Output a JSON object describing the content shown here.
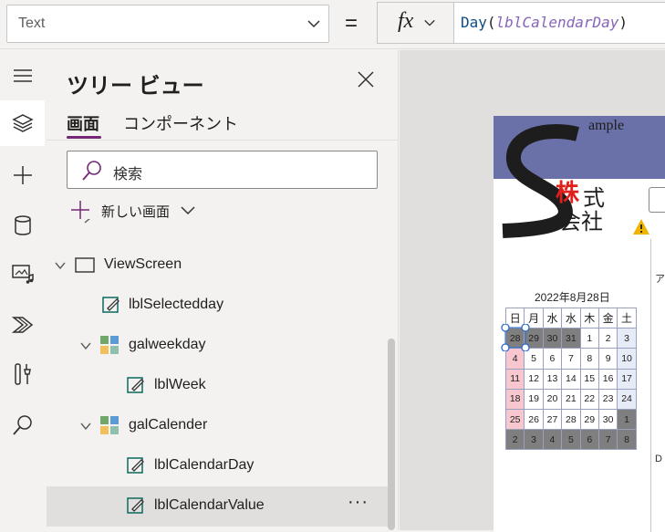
{
  "formula_bar": {
    "property": "Text",
    "equals": "=",
    "fx_label": "fx",
    "formula": {
      "fn": "Day",
      "open": "(",
      "arg": "lblCalendarDay",
      "close": ")"
    }
  },
  "rail": {
    "items": [
      {
        "name": "hamburger-icon"
      },
      {
        "name": "layers-icon",
        "active": true
      },
      {
        "name": "plus-icon"
      },
      {
        "name": "database-icon"
      },
      {
        "name": "media-icon"
      },
      {
        "name": "power-automate-icon"
      },
      {
        "name": "tools-icon"
      },
      {
        "name": "search-icon"
      }
    ]
  },
  "tree": {
    "title": "ツリー ビュー",
    "tabs": {
      "screens": "画面",
      "components": "コンポーネント"
    },
    "search_placeholder": "検索",
    "new_screen": "新しい画面",
    "rows": [
      {
        "label": "ViewScreen",
        "type": "screen",
        "expand": "collapse",
        "indent": 0
      },
      {
        "label": "lblSelectedday",
        "type": "label",
        "indent": 1
      },
      {
        "label": "galweekday",
        "type": "gallery",
        "expand": "collapse",
        "indent": 1
      },
      {
        "label": "lblWeek",
        "type": "label",
        "indent": 2
      },
      {
        "label": "galCalender",
        "type": "gallery",
        "expand": "collapse",
        "indent": 1
      },
      {
        "label": "lblCalendarDay",
        "type": "label",
        "indent": 2
      },
      {
        "label": "lblCalendarValue",
        "type": "label",
        "indent": 2,
        "selected": true
      }
    ],
    "more_label": "···"
  },
  "canvas": {
    "logo": {
      "brand_text": "ample",
      "company_line1": "株式",
      "company_line2": "会社",
      "accent_char": "株"
    },
    "date_label": "2022年8月28日",
    "weekdays": [
      "日",
      "月",
      "水",
      "水",
      "木",
      "金",
      "土"
    ],
    "weeks": [
      [
        {
          "d": "28",
          "t": "out"
        },
        {
          "d": "29",
          "t": "out"
        },
        {
          "d": "30",
          "t": "out"
        },
        {
          "d": "31",
          "t": "out"
        },
        {
          "d": "1",
          "t": ""
        },
        {
          "d": "2",
          "t": ""
        },
        {
          "d": "3",
          "t": "sat"
        }
      ],
      [
        {
          "d": "4",
          "t": "sun"
        },
        {
          "d": "5",
          "t": ""
        },
        {
          "d": "6",
          "t": ""
        },
        {
          "d": "7",
          "t": ""
        },
        {
          "d": "8",
          "t": ""
        },
        {
          "d": "9",
          "t": ""
        },
        {
          "d": "10",
          "t": "sat"
        }
      ],
      [
        {
          "d": "11",
          "t": "sun"
        },
        {
          "d": "12",
          "t": ""
        },
        {
          "d": "13",
          "t": ""
        },
        {
          "d": "14",
          "t": ""
        },
        {
          "d": "15",
          "t": ""
        },
        {
          "d": "16",
          "t": ""
        },
        {
          "d": "17",
          "t": "sat"
        }
      ],
      [
        {
          "d": "18",
          "t": "sun"
        },
        {
          "d": "19",
          "t": ""
        },
        {
          "d": "20",
          "t": ""
        },
        {
          "d": "21",
          "t": ""
        },
        {
          "d": "22",
          "t": ""
        },
        {
          "d": "23",
          "t": ""
        },
        {
          "d": "24",
          "t": "sat"
        }
      ],
      [
        {
          "d": "25",
          "t": "sun"
        },
        {
          "d": "26",
          "t": ""
        },
        {
          "d": "27",
          "t": ""
        },
        {
          "d": "28",
          "t": ""
        },
        {
          "d": "29",
          "t": ""
        },
        {
          "d": "30",
          "t": ""
        },
        {
          "d": "1",
          "t": "out"
        }
      ],
      [
        {
          "d": "2",
          "t": "out"
        },
        {
          "d": "3",
          "t": "out"
        },
        {
          "d": "4",
          "t": "out"
        },
        {
          "d": "5",
          "t": "out"
        },
        {
          "d": "6",
          "t": "out"
        },
        {
          "d": "7",
          "t": "out"
        },
        {
          "d": "8",
          "t": "out"
        }
      ]
    ],
    "side_panel_text1": "ア",
    "side_panel_text2": "D"
  },
  "colors": {
    "accent": "#742774",
    "header_band": "#6a70a8",
    "sunday": "#f7c6cf",
    "saturday": "#e6ebf7",
    "out_of_month": "#7f7f7f",
    "logo_red": "#e0201a",
    "selection_handle": "#2b6cd4"
  }
}
